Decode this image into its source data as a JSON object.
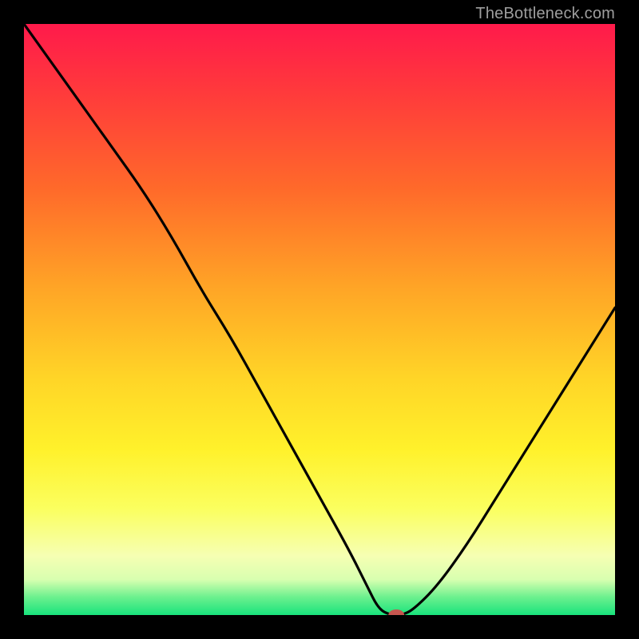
{
  "attribution": "TheBottleneck.com",
  "chart_data": {
    "type": "line",
    "title": "",
    "xlabel": "",
    "ylabel": "",
    "xlim": [
      0,
      100
    ],
    "ylim": [
      0,
      100
    ],
    "gradient_stops": [
      {
        "pos": 0,
        "color": "#ff1a4b"
      },
      {
        "pos": 12,
        "color": "#ff3b3b"
      },
      {
        "pos": 28,
        "color": "#ff6a2a"
      },
      {
        "pos": 45,
        "color": "#ffa626"
      },
      {
        "pos": 60,
        "color": "#ffd527"
      },
      {
        "pos": 72,
        "color": "#fff12b"
      },
      {
        "pos": 82,
        "color": "#fbff5f"
      },
      {
        "pos": 90,
        "color": "#f6ffb3"
      },
      {
        "pos": 94,
        "color": "#d8ffb0"
      },
      {
        "pos": 97,
        "color": "#6bf08e"
      },
      {
        "pos": 100,
        "color": "#18e37c"
      }
    ],
    "series": [
      {
        "name": "bottleneck-curve",
        "x": [
          0,
          5,
          10,
          15,
          20,
          25,
          30,
          35,
          40,
          45,
          50,
          55,
          58,
          60,
          62,
          64,
          66,
          70,
          75,
          80,
          85,
          90,
          95,
          100
        ],
        "y": [
          100,
          93,
          86,
          79,
          72,
          64,
          55,
          47,
          38,
          29,
          20,
          11,
          5,
          1,
          0,
          0,
          1,
          5,
          12,
          20,
          28,
          36,
          44,
          52
        ]
      }
    ],
    "marker": {
      "x": 63,
      "y": 0,
      "color": "#c5564f",
      "rx": 10,
      "ry": 7
    }
  }
}
